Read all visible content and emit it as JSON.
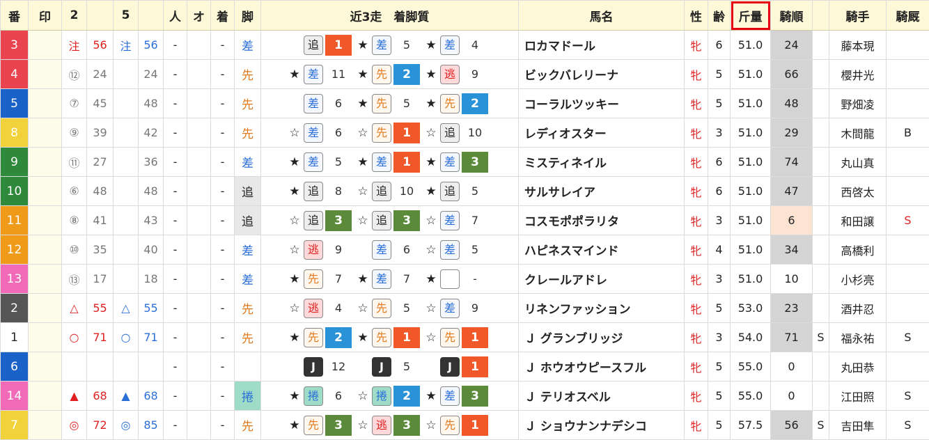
{
  "headers": {
    "ban": "番",
    "in": "印",
    "c2": "2",
    "c2b": "",
    "c5": "5",
    "c5b": "",
    "hito": "人",
    "o": "オ",
    "chaku": "着",
    "kyaku": "脚",
    "recent": "近3走　着脚質",
    "name": "馬名",
    "sex": "性",
    "age": "齢",
    "weight": "斤量",
    "jorder": "騎順",
    "sflag": "",
    "jockey": "騎手",
    "jstable": "騎厩"
  },
  "colors": {
    "highlight": "#e60012",
    "header_bg": "#fdf9d8"
  },
  "rows": [
    {
      "ban": "3",
      "ban_color": "#e8434f",
      "m1": "注",
      "v1": "56",
      "m2": "注",
      "v2": "56",
      "m1c": "red",
      "m2c": "blue",
      "hito": "-",
      "chaku": "-",
      "kyaku": "差",
      "kyaku_cls": "blue",
      "recent": [
        {
          "star": "",
          "box": "追",
          "bc": "c-oi",
          "place": "1",
          "pc": "p1"
        },
        {
          "star": "★",
          "box": "差",
          "bc": "c-sa",
          "place": "5",
          "pc": ""
        },
        {
          "star": "★",
          "box": "差",
          "bc": "c-sa",
          "place": "4",
          "pc": ""
        }
      ],
      "name": "ロカマドール",
      "sex": "牝",
      "age": "6",
      "weight": "51.0",
      "jorder": "24",
      "jcls": "",
      "sflag": "",
      "jockey": "藤本現",
      "jstable": ""
    },
    {
      "ban": "4",
      "ban_color": "#e8434f",
      "m1": "⑫",
      "v1": "24",
      "m2": "",
      "v2": "24",
      "m1c": "gray",
      "m2c": "gray",
      "hito": "-",
      "chaku": "-",
      "kyaku": "先",
      "kyaku_cls": "orange",
      "recent": [
        {
          "star": "★",
          "box": "差",
          "bc": "c-sa",
          "place": "11",
          "pc": ""
        },
        {
          "star": "★",
          "box": "先",
          "bc": "c-sen",
          "place": "2",
          "pc": "p2"
        },
        {
          "star": "★",
          "box": "逃",
          "bc": "c-nige",
          "place": "9",
          "pc": ""
        }
      ],
      "name": "ビックバレリーナ",
      "sex": "牝",
      "age": "5",
      "weight": "51.0",
      "jorder": "66",
      "jcls": "",
      "sflag": "",
      "jockey": "櫻井光",
      "jstable": ""
    },
    {
      "ban": "5",
      "ban_color": "#1a62c8",
      "m1": "⑦",
      "v1": "45",
      "m2": "",
      "v2": "48",
      "m1c": "gray",
      "m2c": "gray",
      "hito": "-",
      "chaku": "-",
      "kyaku": "先",
      "kyaku_cls": "orange",
      "recent": [
        {
          "star": "",
          "box": "差",
          "bc": "c-sa",
          "place": "6",
          "pc": ""
        },
        {
          "star": "★",
          "box": "先",
          "bc": "c-sen",
          "place": "5",
          "pc": ""
        },
        {
          "star": "★",
          "box": "先",
          "bc": "c-sen",
          "place": "2",
          "pc": "p2"
        }
      ],
      "name": "コーラルツッキー",
      "sex": "牝",
      "age": "5",
      "weight": "51.0",
      "jorder": "48",
      "jcls": "",
      "sflag": "",
      "jockey": "野畑凌",
      "jstable": ""
    },
    {
      "ban": "8",
      "ban_color": "#f2d23a",
      "m1": "⑨",
      "v1": "39",
      "m2": "",
      "v2": "42",
      "m1c": "gray",
      "m2c": "gray",
      "hito": "-",
      "chaku": "-",
      "kyaku": "先",
      "kyaku_cls": "orange",
      "recent": [
        {
          "star": "☆",
          "box": "差",
          "bc": "c-sa",
          "place": "6",
          "pc": ""
        },
        {
          "star": "☆",
          "box": "先",
          "bc": "c-sen",
          "place": "1",
          "pc": "p1"
        },
        {
          "star": "☆",
          "box": "追",
          "bc": "c-oi",
          "place": "10",
          "pc": ""
        }
      ],
      "name": "レディオスター",
      "sex": "牝",
      "age": "3",
      "weight": "51.0",
      "jorder": "29",
      "jcls": "",
      "sflag": "",
      "jockey": "木間龍",
      "jstable": "B"
    },
    {
      "ban": "9",
      "ban_color": "#2e8a3a",
      "m1": "⑪",
      "v1": "27",
      "m2": "",
      "v2": "36",
      "m1c": "gray",
      "m2c": "gray",
      "hito": "-",
      "chaku": "-",
      "kyaku": "差",
      "kyaku_cls": "blue",
      "recent": [
        {
          "star": "★",
          "box": "差",
          "bc": "c-sa",
          "place": "5",
          "pc": ""
        },
        {
          "star": "★",
          "box": "差",
          "bc": "c-sa",
          "place": "1",
          "pc": "p1"
        },
        {
          "star": "★",
          "box": "差",
          "bc": "c-sa",
          "place": "3",
          "pc": "p3"
        }
      ],
      "name": "ミスティネイル",
      "sex": "牝",
      "age": "6",
      "weight": "51.0",
      "jorder": "74",
      "jcls": "",
      "sflag": "",
      "jockey": "丸山真",
      "jstable": ""
    },
    {
      "ban": "10",
      "ban_color": "#2e8a3a",
      "m1": "⑥",
      "v1": "48",
      "m2": "",
      "v2": "48",
      "m1c": "gray",
      "m2c": "gray",
      "hito": "-",
      "chaku": "-",
      "kyaku": "追",
      "kyaku_cls": "",
      "kyaku_bg": "style-bg",
      "recent": [
        {
          "star": "★",
          "box": "追",
          "bc": "c-oi",
          "place": "8",
          "pc": ""
        },
        {
          "star": "☆",
          "box": "追",
          "bc": "c-oi",
          "place": "10",
          "pc": ""
        },
        {
          "star": "★",
          "box": "追",
          "bc": "c-oi",
          "place": "5",
          "pc": ""
        }
      ],
      "name": "サルサレイア",
      "sex": "牝",
      "age": "6",
      "weight": "51.0",
      "jorder": "47",
      "jcls": "",
      "sflag": "",
      "jockey": "西啓太",
      "jstable": ""
    },
    {
      "ban": "11",
      "ban_color": "#f09a1a",
      "m1": "⑧",
      "v1": "41",
      "m2": "",
      "v2": "43",
      "m1c": "gray",
      "m2c": "gray",
      "hito": "-",
      "chaku": "-",
      "kyaku": "追",
      "kyaku_cls": "",
      "kyaku_bg": "style-bg",
      "recent": [
        {
          "star": "☆",
          "box": "追",
          "bc": "c-oi",
          "place": "3",
          "pc": "p3"
        },
        {
          "star": "☆",
          "box": "追",
          "bc": "c-oi",
          "place": "3",
          "pc": "p3"
        },
        {
          "star": "☆",
          "box": "差",
          "bc": "c-sa",
          "place": "7",
          "pc": ""
        }
      ],
      "name": "コスモポポラリタ",
      "sex": "牝",
      "age": "3",
      "weight": "51.0",
      "jorder": "6",
      "jcls": "low",
      "sflag": "",
      "jockey": "和田譲",
      "jstable": "S",
      "jstable_red": true
    },
    {
      "ban": "12",
      "ban_color": "#f09a1a",
      "m1": "⑩",
      "v1": "35",
      "m2": "",
      "v2": "40",
      "m1c": "gray",
      "m2c": "gray",
      "hito": "-",
      "chaku": "-",
      "kyaku": "差",
      "kyaku_cls": "blue",
      "recent": [
        {
          "star": "☆",
          "box": "逃",
          "bc": "c-nige",
          "place": "9",
          "pc": ""
        },
        {
          "star": "",
          "box": "差",
          "bc": "c-sa",
          "place": "6",
          "pc": ""
        },
        {
          "star": "☆",
          "box": "差",
          "bc": "c-sa",
          "place": "5",
          "pc": ""
        }
      ],
      "name": "ハピネスマインド",
      "sex": "牝",
      "age": "4",
      "weight": "51.0",
      "jorder": "34",
      "jcls": "",
      "sflag": "",
      "jockey": "高橋利",
      "jstable": ""
    },
    {
      "ban": "13",
      "ban_color": "#f06ab8",
      "m1": "⑬",
      "v1": "17",
      "m2": "",
      "v2": "18",
      "m1c": "gray",
      "m2c": "gray",
      "hito": "-",
      "chaku": "-",
      "kyaku": "差",
      "kyaku_cls": "blue",
      "recent": [
        {
          "star": "★",
          "box": "先",
          "bc": "c-sen",
          "place": "7",
          "pc": ""
        },
        {
          "star": "★",
          "box": "差",
          "bc": "c-sa",
          "place": "7",
          "pc": ""
        },
        {
          "star": "★",
          "box": "",
          "bc": "c-empty",
          "place": "-",
          "pc": ""
        }
      ],
      "name": "クレールアドレ",
      "sex": "牝",
      "age": "3",
      "weight": "51.0",
      "jorder": "10",
      "jcls": "none",
      "sflag": "",
      "jockey": "小杉亮",
      "jstable": ""
    },
    {
      "ban": "2",
      "ban_color": "#555555",
      "m1": "△",
      "v1": "55",
      "m2": "△",
      "v2": "55",
      "m1c": "red",
      "m2c": "blue",
      "hito": "-",
      "chaku": "-",
      "kyaku": "先",
      "kyaku_cls": "orange",
      "recent": [
        {
          "star": "☆",
          "box": "逃",
          "bc": "c-nige",
          "place": "4",
          "pc": ""
        },
        {
          "star": "☆",
          "box": "先",
          "bc": "c-sen",
          "place": "5",
          "pc": ""
        },
        {
          "star": "☆",
          "box": "差",
          "bc": "c-sa",
          "place": "9",
          "pc": ""
        }
      ],
      "name": "リネンファッション",
      "sex": "牝",
      "age": "5",
      "weight": "53.0",
      "jorder": "23",
      "jcls": "",
      "sflag": "",
      "jockey": "酒井忍",
      "jstable": ""
    },
    {
      "ban": "1",
      "ban_color": "#ffffff",
      "ban_text": "#222",
      "m1": "○",
      "v1": "71",
      "m2": "○",
      "v2": "71",
      "m1c": "red",
      "m2c": "blue",
      "hito": "-",
      "chaku": "-",
      "kyaku": "先",
      "kyaku_cls": "orange",
      "recent": [
        {
          "star": "★",
          "box": "先",
          "bc": "c-sen",
          "place": "2",
          "pc": "p2"
        },
        {
          "star": "★",
          "box": "先",
          "bc": "c-sen",
          "place": "1",
          "pc": "p1"
        },
        {
          "star": "☆",
          "box": "先",
          "bc": "c-sen",
          "place": "1",
          "pc": "p1"
        }
      ],
      "name": "Ｊ グランブリッジ",
      "sex": "牝",
      "age": "3",
      "weight": "54.0",
      "jorder": "71",
      "jcls": "",
      "sflag": "S",
      "jockey": "福永祐",
      "jstable": "S"
    },
    {
      "ban": "6",
      "ban_color": "#1a62c8",
      "m1": "",
      "v1": "",
      "m2": "",
      "v2": "",
      "m1c": "gray",
      "m2c": "gray",
      "hito": "-",
      "chaku": "-",
      "kyaku": "",
      "kyaku_cls": "",
      "recent": [
        {
          "star": "",
          "box": "J",
          "bc": "c-J",
          "place": "12",
          "pc": ""
        },
        {
          "star": "",
          "box": "J",
          "bc": "c-J",
          "place": "5",
          "pc": ""
        },
        {
          "star": "",
          "box": "J",
          "bc": "c-J",
          "place": "1",
          "pc": "p1"
        }
      ],
      "name": "Ｊ ホウオウピースフル",
      "sex": "牝",
      "age": "5",
      "weight": "55.0",
      "jorder": "0",
      "jcls": "none",
      "sflag": "",
      "jockey": "丸田恭",
      "jstable": ""
    },
    {
      "ban": "14",
      "ban_color": "#f06ab8",
      "m1": "▲",
      "v1": "68",
      "m2": "▲",
      "v2": "68",
      "m1c": "red",
      "m2c": "blue",
      "hito": "-",
      "chaku": "-",
      "kyaku": "捲",
      "kyaku_cls": "blue",
      "kyaku_bg": "style-bg-green",
      "recent": [
        {
          "star": "★",
          "box": "捲",
          "bc": "c-maku",
          "place": "6",
          "pc": ""
        },
        {
          "star": "☆",
          "box": "捲",
          "bc": "c-maku",
          "place": "2",
          "pc": "p2"
        },
        {
          "star": "★",
          "box": "差",
          "bc": "c-sa",
          "place": "3",
          "pc": "p3"
        }
      ],
      "name": "Ｊ テリオスベル",
      "sex": "牝",
      "age": "5",
      "weight": "55.0",
      "jorder": "0",
      "jcls": "none",
      "sflag": "",
      "jockey": "江田照",
      "jstable": "S"
    },
    {
      "ban": "7",
      "ban_color": "#f2d23a",
      "m1": "◎",
      "v1": "72",
      "m2": "◎",
      "v2": "85",
      "m1c": "red",
      "m2c": "blue",
      "hito": "-",
      "chaku": "-",
      "kyaku": "先",
      "kyaku_cls": "orange",
      "recent": [
        {
          "star": "★",
          "box": "先",
          "bc": "c-sen",
          "place": "3",
          "pc": "p3"
        },
        {
          "star": "☆",
          "box": "逃",
          "bc": "c-nige",
          "place": "3",
          "pc": "p3"
        },
        {
          "star": "☆",
          "box": "先",
          "bc": "c-sen",
          "place": "1",
          "pc": "p1"
        }
      ],
      "name": "Ｊ ショウナンナデシコ",
      "sex": "牝",
      "age": "5",
      "weight": "57.5",
      "jorder": "56",
      "jcls": "",
      "sflag": "S",
      "jockey": "吉田隼",
      "jstable": "S"
    }
  ]
}
